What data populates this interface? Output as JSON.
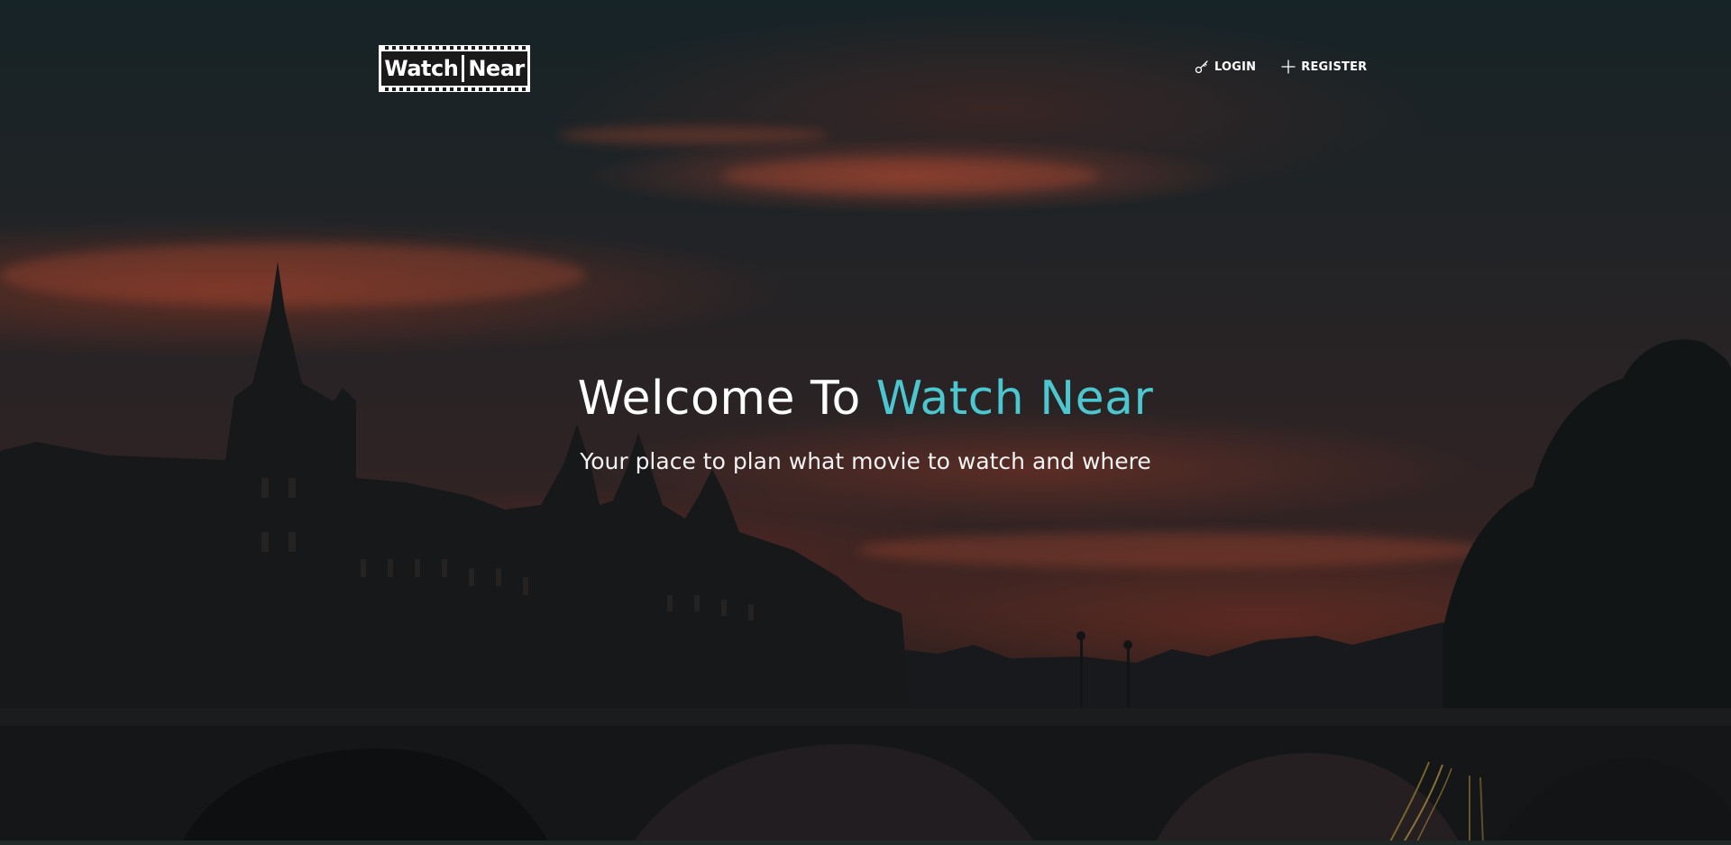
{
  "header": {
    "logo": {
      "word1": "Watch",
      "word2": "Near"
    },
    "nav": {
      "login_label": "LOGIN",
      "register_label": "REGISTER",
      "login_icon": "key-icon",
      "register_icon": "plus-icon"
    }
  },
  "hero": {
    "headline_prefix": "Welcome To ",
    "headline_accent": "Watch Near",
    "subheadline": "Your place to plan what movie to watch and where"
  },
  "colors": {
    "accent": "#4cc6cf",
    "text": "#ffffff"
  }
}
